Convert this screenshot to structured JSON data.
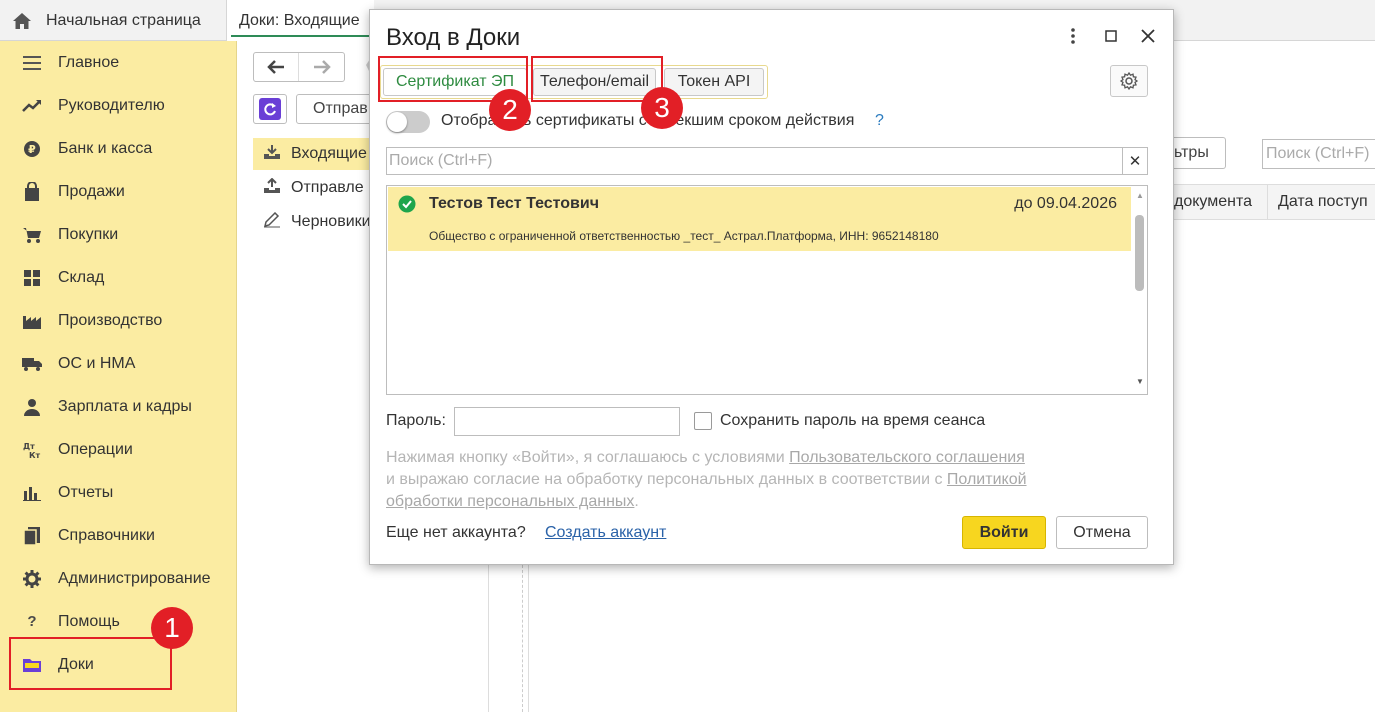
{
  "top_tabs": {
    "home_label": "Начальная страница",
    "doc_tab_label": "Доки: Входящие"
  },
  "sidebar": {
    "items": [
      {
        "label": "Главное",
        "icon": "menu-icon"
      },
      {
        "label": "Руководителю",
        "icon": "trend-icon"
      },
      {
        "label": "Банк и касса",
        "icon": "ruble-icon"
      },
      {
        "label": "Продажи",
        "icon": "bag-icon"
      },
      {
        "label": "Покупки",
        "icon": "cart-icon"
      },
      {
        "label": "Склад",
        "icon": "grid-icon"
      },
      {
        "label": "Производство",
        "icon": "factory-icon"
      },
      {
        "label": "ОС и НМА",
        "icon": "truck-icon"
      },
      {
        "label": "Зарплата и кадры",
        "icon": "person-icon"
      },
      {
        "label": "Операции",
        "icon": "dtkt-icon"
      },
      {
        "label": "Отчеты",
        "icon": "bars-icon"
      },
      {
        "label": "Справочники",
        "icon": "books-icon"
      },
      {
        "label": "Администрирование",
        "icon": "gear-icon"
      },
      {
        "label": "Помощь",
        "icon": "question-icon"
      },
      {
        "label": "Доки",
        "icon": "folder-icon"
      }
    ]
  },
  "background": {
    "send_button": "Отправ",
    "list": [
      "Входящие",
      "Отправле",
      "Черновики"
    ],
    "filters_button": "ьтры",
    "search_placeholder": "Поиск (Ctrl+F)",
    "columns": [
      "документа",
      "Дата поступ"
    ]
  },
  "dialog": {
    "title": "Вход в Доки",
    "tabs": [
      "Сертификат ЭП",
      "Телефон/email",
      "Токен API"
    ],
    "toggle_label": "Отображать сертификаты с истекшим сроком действия",
    "toggle_help": "?",
    "search_placeholder": "Поиск (Ctrl+F)",
    "certificate": {
      "name": "Тестов Тест Тестович",
      "valid_until": "до 09.04.2026",
      "org": "Общество с ограниченной ответственностью _тест_ Астрал.Платформа, ИНН: 9652148180"
    },
    "password_label": "Пароль:",
    "save_password_label": "Сохранить пароль на время сеанса",
    "legal": {
      "text1": "Нажимая кнопку «Войти», я соглашаюсь с условиями ",
      "link1": "Пользовательского соглашения",
      "text2": "и выражаю согласие на обработку персональных данных в соответствии с ",
      "link2a": "Политикой",
      "link2b": "обработки персональных данных",
      "text3": "."
    },
    "no_account": "Еще нет аккаунта?",
    "create_account": "Создать аккаунт",
    "login_button": "Войти",
    "cancel_button": "Отмена"
  },
  "annotations": [
    "1",
    "2",
    "3"
  ],
  "colors": {
    "sidebar_bg": "#fbeca2",
    "accent_green": "#2e8b40",
    "login_yellow": "#f7d61f",
    "annotation_red": "#e21f26"
  }
}
